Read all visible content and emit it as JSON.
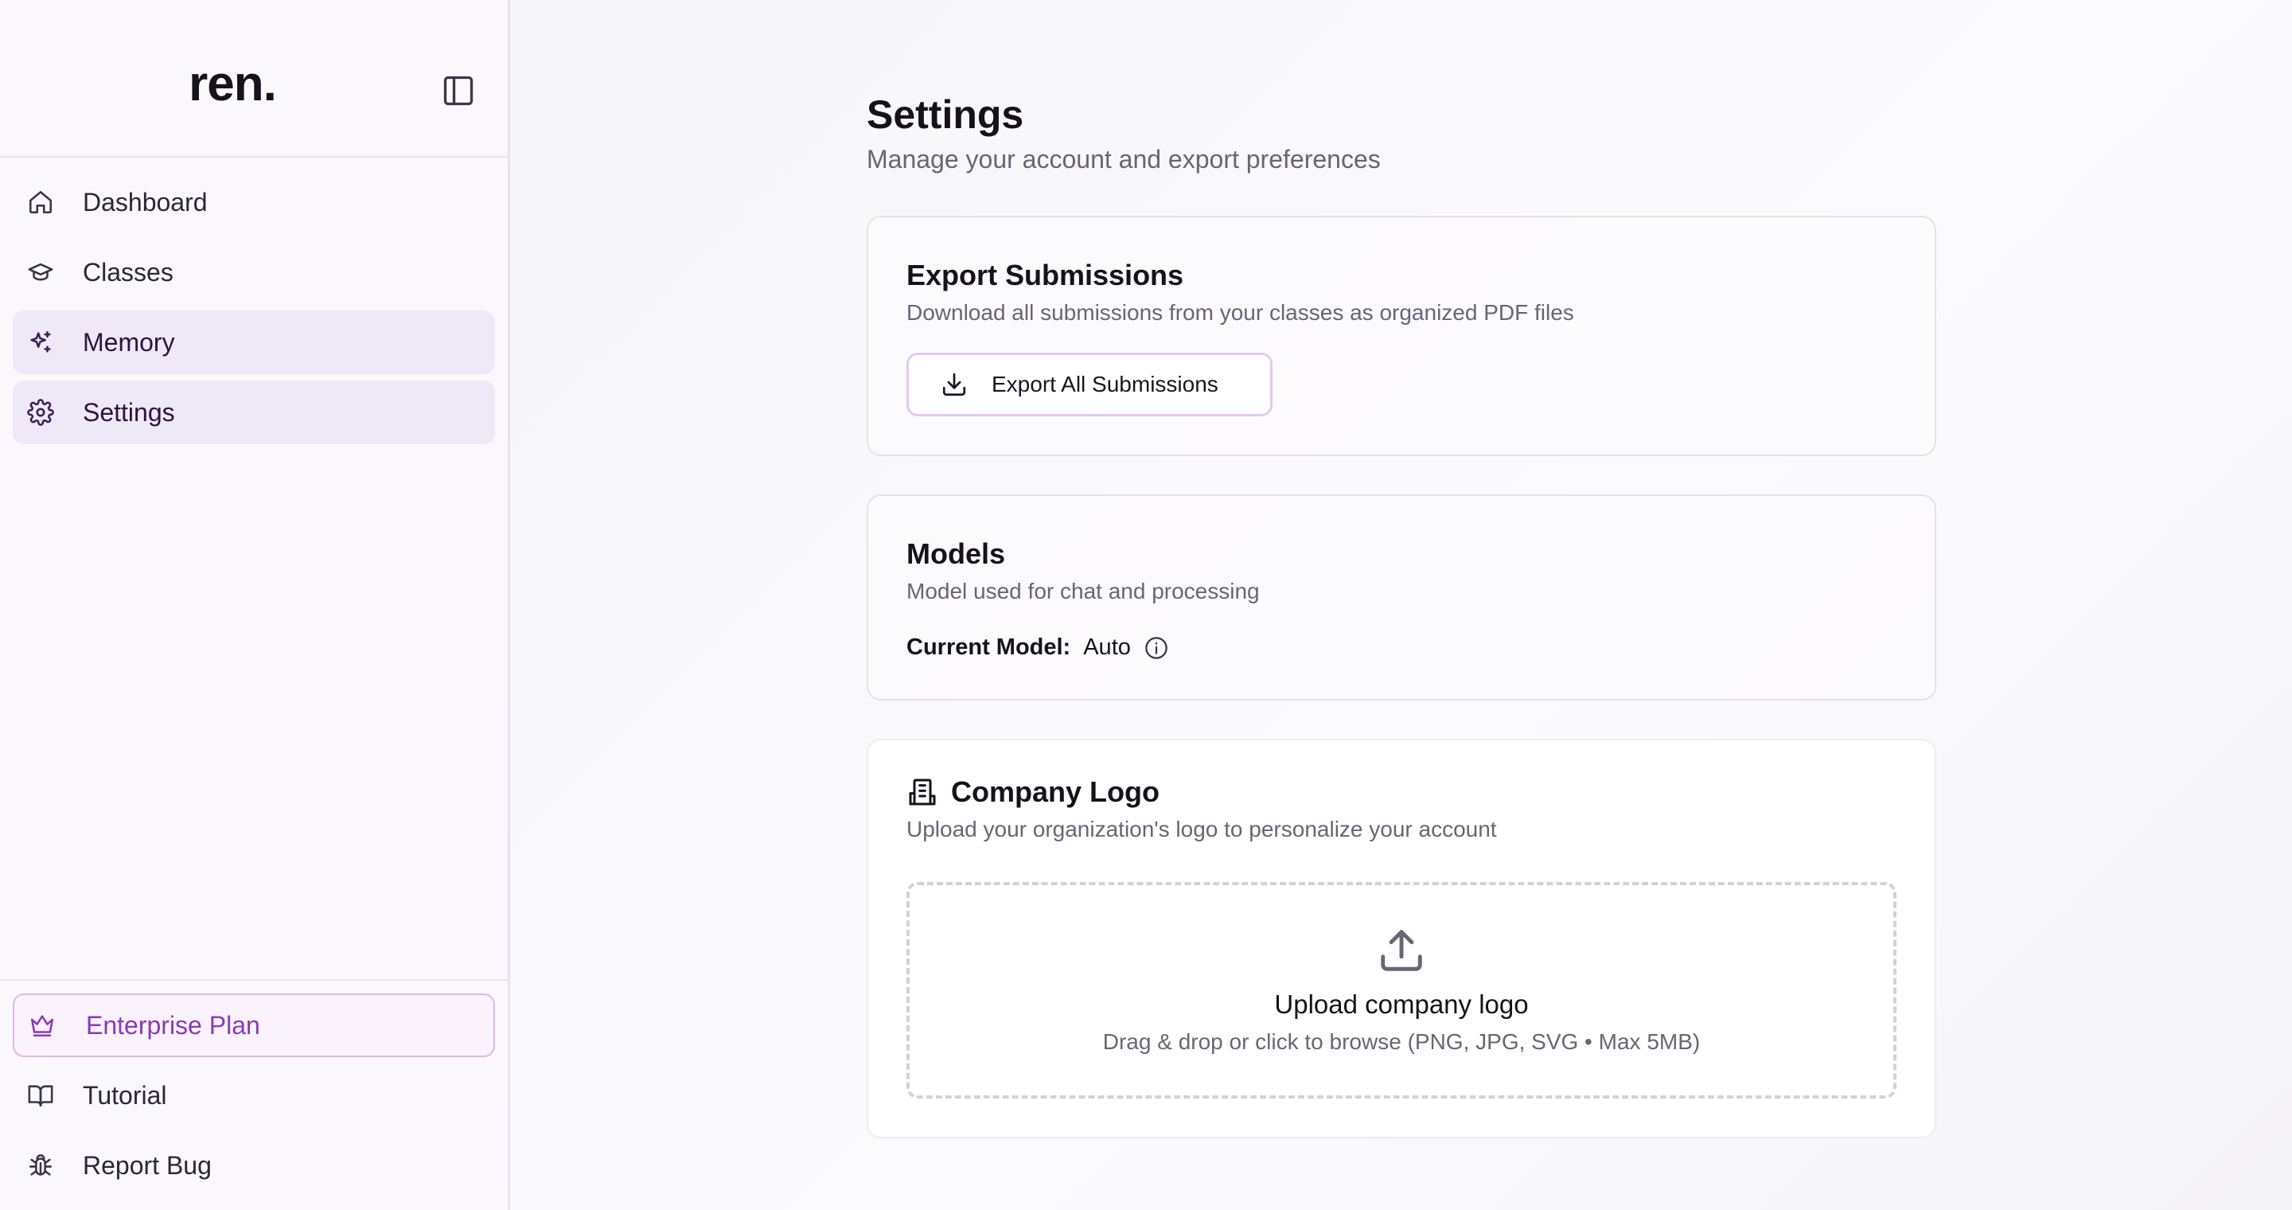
{
  "sidebar": {
    "logo": "ren.",
    "nav": [
      {
        "label": "Dashboard",
        "icon": "home-icon",
        "active": false
      },
      {
        "label": "Classes",
        "icon": "graduation-cap-icon",
        "active": false
      },
      {
        "label": "Memory",
        "icon": "sparkles-icon",
        "active": true
      },
      {
        "label": "Settings",
        "icon": "gear-icon",
        "active": true
      }
    ],
    "bottom": {
      "plan_label": "Enterprise Plan",
      "tutorial_label": "Tutorial",
      "report_bug_label": "Report Bug"
    }
  },
  "page": {
    "title": "Settings",
    "subtitle": "Manage your account and export preferences"
  },
  "export_card": {
    "title": "Export Submissions",
    "description": "Download all submissions from your classes as organized PDF files",
    "button_label": "Export All Submissions"
  },
  "models_card": {
    "title": "Models",
    "description": "Model used for chat and processing",
    "current_model_label": "Current Model:",
    "current_model_value": "Auto"
  },
  "logo_card": {
    "title": "Company Logo",
    "description": "Upload your organization's logo to personalize your account",
    "upload_title": "Upload company logo",
    "upload_hint": "Drag & drop or click to browse (PNG, JPG, SVG • Max 5MB)"
  },
  "colors": {
    "accent": "#8a3bb5",
    "active_bg": "#efe8f6",
    "plan_border": "#d9b8ee"
  }
}
